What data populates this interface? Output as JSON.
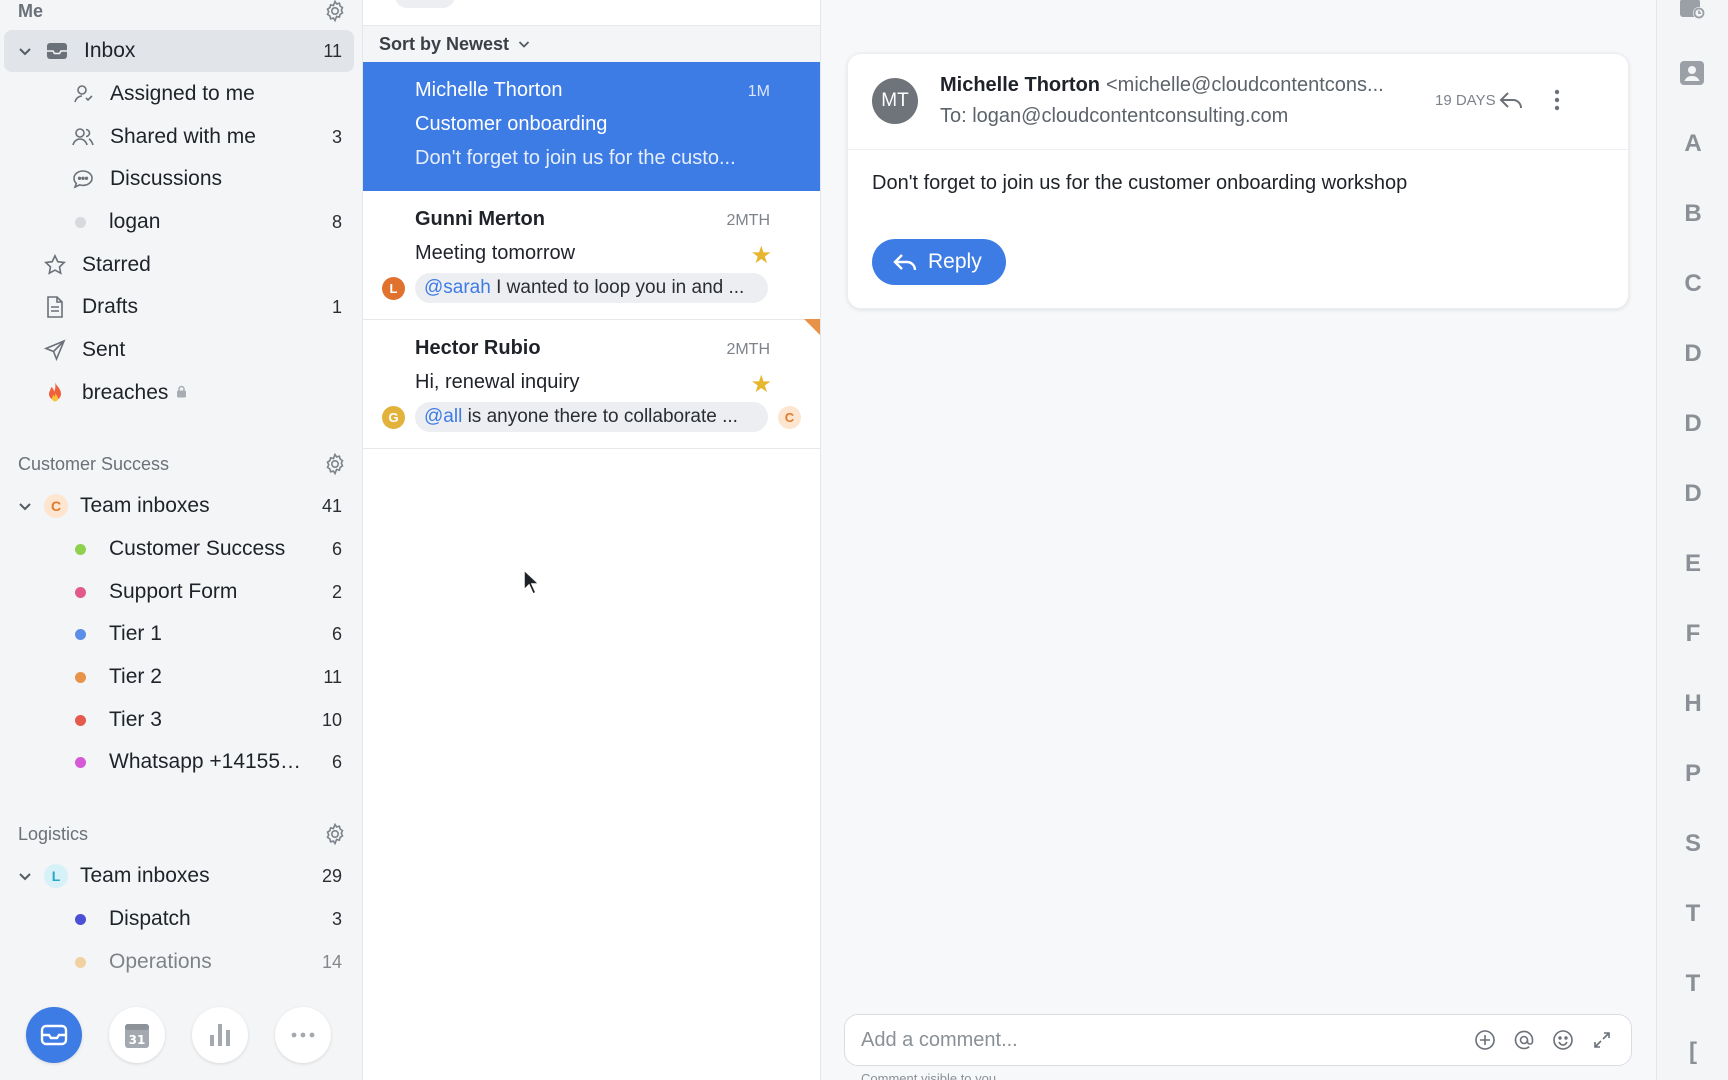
{
  "sidebar": {
    "me_section": {
      "label": "Me"
    },
    "me_items": [
      {
        "label": "Inbox",
        "count": "11",
        "icon": "inbox-icon"
      },
      {
        "label": "Assigned to me",
        "count": "",
        "icon": "assigned-icon"
      },
      {
        "label": "Shared with me",
        "count": "3",
        "icon": "people-icon"
      },
      {
        "label": "Discussions",
        "count": "",
        "icon": "chat-bubble-icon"
      },
      {
        "label": "logan",
        "count": "8",
        "dot": "#d6d9dd"
      },
      {
        "label": "Starred",
        "count": "",
        "icon": "star-icon"
      },
      {
        "label": "Drafts",
        "count": "1",
        "icon": "draft-icon"
      },
      {
        "label": "Sent",
        "count": "",
        "icon": "send-icon"
      },
      {
        "label": "breaches",
        "count": "",
        "icon": "fire-icon",
        "locked": true
      }
    ],
    "customer_success": {
      "label": "Customer Success",
      "team": {
        "label": "Team inboxes",
        "count": "41",
        "badge": "C",
        "badge_color": "#fde5cf",
        "badge_text_color": "#e07b2c"
      },
      "items": [
        {
          "label": "Customer Success",
          "count": "6",
          "dot": "#8fd14f"
        },
        {
          "label": "Support Form",
          "count": "2",
          "dot": "#e25a8a"
        },
        {
          "label": "Tier 1",
          "count": "6",
          "dot": "#5b8ee6"
        },
        {
          "label": "Tier 2",
          "count": "11",
          "dot": "#e7944a"
        },
        {
          "label": "Tier 3",
          "count": "10",
          "dot": "#e45b4e"
        },
        {
          "label": "Whatsapp +141553...",
          "count": "6",
          "dot": "#d45ad6"
        }
      ]
    },
    "logistics": {
      "label": "Logistics",
      "team": {
        "label": "Team inboxes",
        "count": "29",
        "badge": "L",
        "badge_color": "#d6f1f7",
        "badge_text_color": "#2aa7c5"
      },
      "items": [
        {
          "label": "Dispatch",
          "count": "3",
          "dot": "#4b4fd6"
        },
        {
          "label": "Operations",
          "count": "14",
          "dot": "#f0b45c"
        }
      ]
    },
    "bottom_buttons": [
      "inbox-icon",
      "calendar-icon",
      "analytics-icon",
      "more-icon"
    ],
    "calendar_day": "31"
  },
  "list": {
    "sort_label": "Sort by Newest",
    "messages": [
      {
        "sender": "Michelle Thorton",
        "time": "1M",
        "subject": "Customer onboarding",
        "snippet": "Don't forget to join us for the custo...",
        "selected": true
      },
      {
        "sender": "Gunni Merton",
        "time": "2MTH",
        "subject": "Meeting tomorrow",
        "starred": true,
        "comment_avatar": "L",
        "comment_avatar_color": "#e0722e",
        "comment_mention": "@sarah",
        "comment_text": " I wanted to loop you in and ..."
      },
      {
        "sender": "Hector Rubio",
        "time": "2MTH",
        "subject": "Hi, renewal inquiry",
        "starred": true,
        "comment_avatar": "G",
        "comment_avatar_color": "#e2b23a",
        "comment_mention": "@all",
        "comment_text": " is anyone there to collaborate ...",
        "extra_avatar": "C"
      }
    ]
  },
  "email": {
    "avatar": "MT",
    "from_name": "Michelle Thorton",
    "from_addr": "<michelle@cloudcontentcons...",
    "to": "To: logan@cloudcontentconsulting.com",
    "age": "19 DAYS",
    "body": "Don't forget to join us for the customer onboarding workshop",
    "reply_label": "Reply"
  },
  "comment": {
    "placeholder": "Add a comment...",
    "note": "Comment visible to you"
  },
  "rail": {
    "letters": [
      "A",
      "B",
      "C",
      "D",
      "D",
      "D",
      "E",
      "F",
      "H",
      "P",
      "S",
      "T",
      "T",
      "["
    ]
  },
  "colors": {
    "accent": "#3d7be5",
    "star": "#e6b62f"
  }
}
